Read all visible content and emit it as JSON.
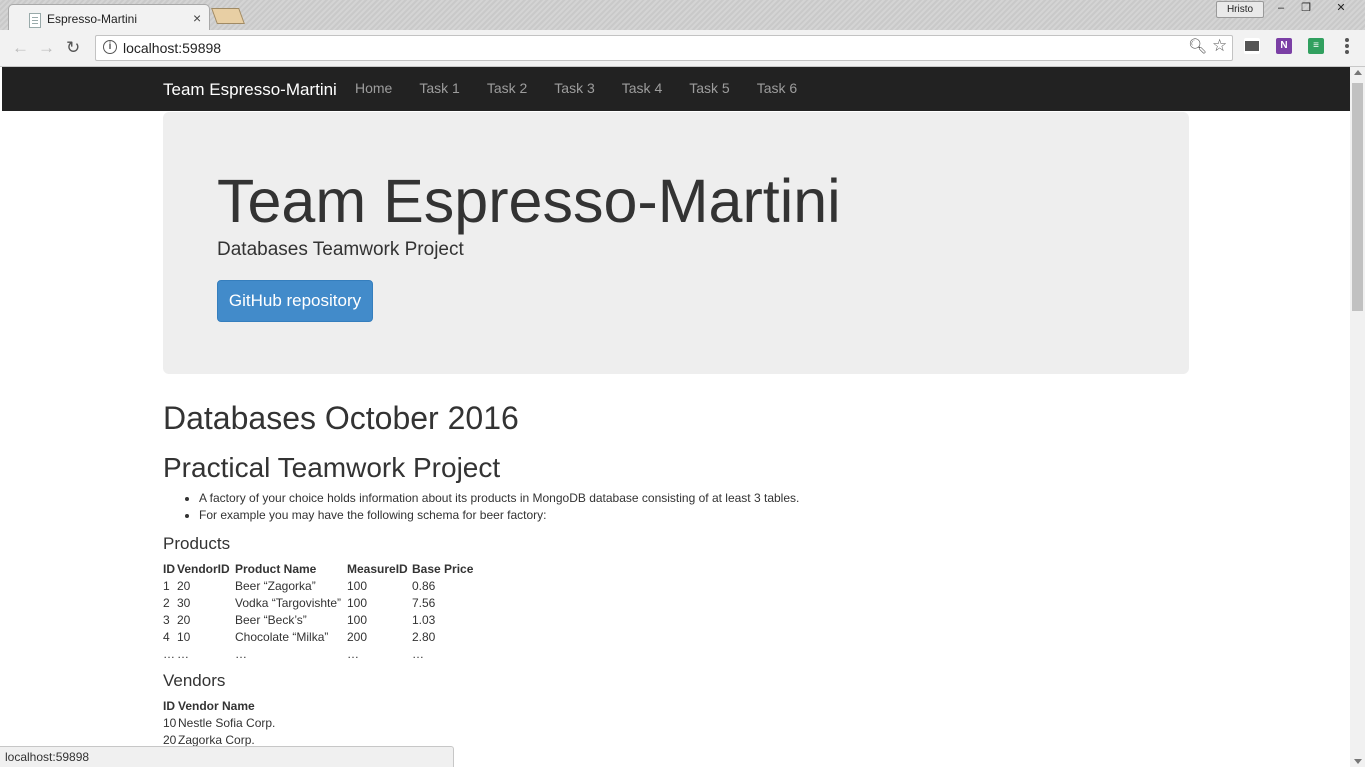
{
  "browser": {
    "tab_title": "Espresso-Martini",
    "tab_close": "×",
    "user_name": "Hristo",
    "url": "localhost:59898",
    "status_url": "localhost:59898"
  },
  "navbar": {
    "brand": "Team Espresso-Martini",
    "links": [
      "Home",
      "Task 1",
      "Task 2",
      "Task 3",
      "Task 4",
      "Task 5",
      "Task 6"
    ]
  },
  "jumbotron": {
    "title": "Team Espresso-Martini",
    "subtitle": "Databases Teamwork Project",
    "button": "GitHub repository"
  },
  "content": {
    "heading": "Databases October 2016",
    "subheading": "Practical Teamwork Project",
    "bullets": [
      "A factory of your choice holds information about its products in MongoDB database consisting of at least 3 tables.",
      "For example you may have the following schema for beer factory:"
    ],
    "products": {
      "title": "Products",
      "headers": [
        "ID",
        "VendorID",
        "Product Name",
        "MeasureID",
        "Base Price"
      ],
      "rows": [
        [
          "1",
          "20",
          "Beer “Zagorka”",
          "100",
          "0.86"
        ],
        [
          "2",
          "30",
          "Vodka “Targovishte”",
          "100",
          "7.56"
        ],
        [
          "3",
          "20",
          "Beer “Beck’s”",
          "100",
          "1.03"
        ],
        [
          "4",
          "10",
          "Chocolate “Milka”",
          "200",
          "2.80"
        ],
        [
          "…",
          "…",
          "…",
          "…",
          "…"
        ]
      ]
    },
    "vendors": {
      "title": "Vendors",
      "headers": [
        "ID",
        "Vendor Name"
      ],
      "rows": [
        [
          "10",
          "Nestle Sofia Corp."
        ],
        [
          "20",
          "Zagorka Corp."
        ]
      ]
    }
  }
}
